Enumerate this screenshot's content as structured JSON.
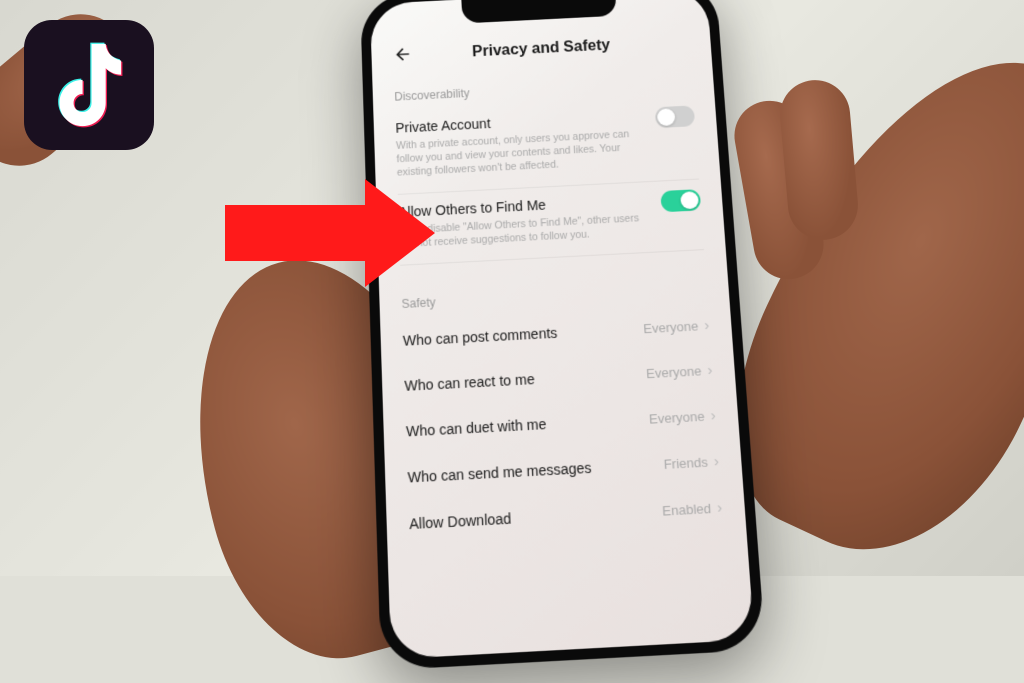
{
  "header": {
    "title": "Privacy and Safety"
  },
  "discoverability": {
    "section_label": "Discoverability",
    "private_account": {
      "title": "Private Account",
      "desc": "With a private account, only users you approve can follow you and view your contents and likes. Your existing followers won't be affected."
    },
    "allow_find": {
      "title": "Allow Others to Find Me",
      "desc": "If you disable \"Allow Others to Find Me\", other users will not receive suggestions to follow you."
    }
  },
  "safety": {
    "section_label": "Safety",
    "rows": [
      {
        "label": "Who can post comments",
        "value": "Everyone"
      },
      {
        "label": "Who can react to me",
        "value": "Everyone"
      },
      {
        "label": "Who can duet with me",
        "value": "Everyone"
      },
      {
        "label": "Who can send me messages",
        "value": "Friends"
      },
      {
        "label": "Allow Download",
        "value": "Enabled"
      }
    ]
  }
}
